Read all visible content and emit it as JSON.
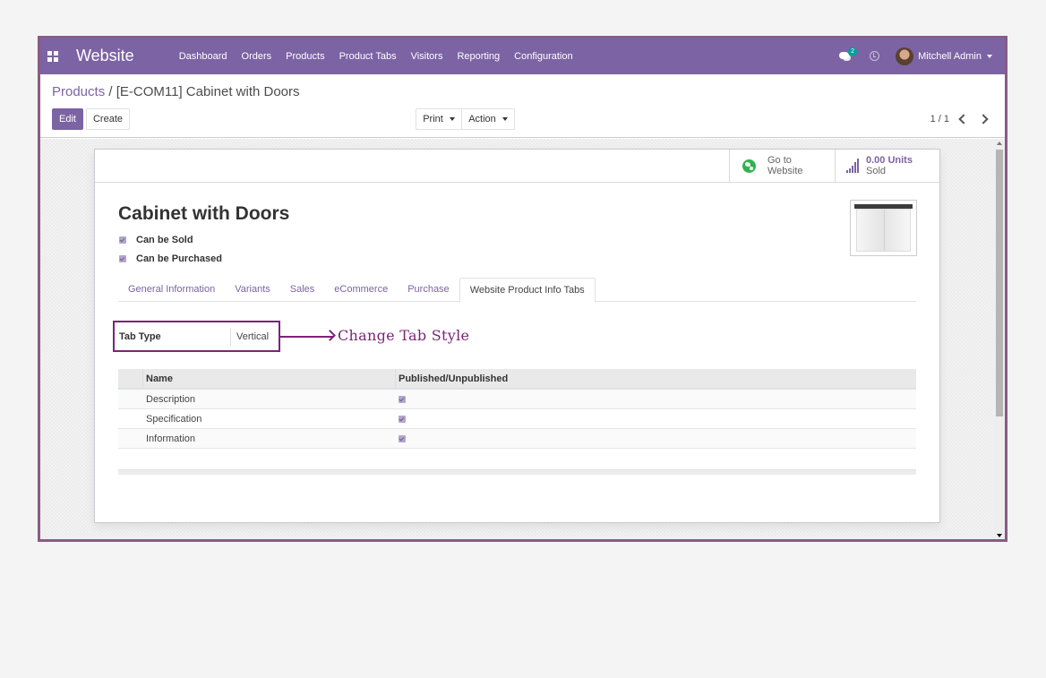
{
  "navbar": {
    "app_name": "Website",
    "menu": [
      "Dashboard",
      "Orders",
      "Products",
      "Product Tabs",
      "Visitors",
      "Reporting",
      "Configuration"
    ],
    "messages_count": "2",
    "user_name": "Mitchell Admin",
    "colors": {
      "brand": "#7c63a3",
      "badge": "#00a09d"
    }
  },
  "control_panel": {
    "breadcrumb_parent": "Products",
    "breadcrumb_separator": "/",
    "breadcrumb_current": "[E-COM11] Cabinet with Doors",
    "edit_label": "Edit",
    "create_label": "Create",
    "print_label": "Print",
    "action_label": "Action",
    "pager": "1 / 1"
  },
  "form": {
    "stat_buttons": {
      "website_line1": "Go to",
      "website_line2": "Website",
      "sold_value": "0.00 Units",
      "sold_label": "Sold"
    },
    "product_name": "Cabinet with Doors",
    "can_be_sold_label": "Can be Sold",
    "can_be_sold": true,
    "can_be_purchased_label": "Can be Purchased",
    "can_be_purchased": true,
    "tabs": [
      {
        "label": "General Information",
        "active": false
      },
      {
        "label": "Variants",
        "active": false
      },
      {
        "label": "Sales",
        "active": false
      },
      {
        "label": "eCommerce",
        "active": false
      },
      {
        "label": "Purchase",
        "active": false
      },
      {
        "label": "Website Product Info Tabs",
        "active": true
      }
    ],
    "tab_type_label": "Tab Type",
    "tab_type_value": "Vertical",
    "annotation": "Change Tab Style",
    "table": {
      "columns": [
        "Name",
        "Published/Unpublished"
      ],
      "rows": [
        {
          "name": "Description",
          "published": true
        },
        {
          "name": "Specification",
          "published": true
        },
        {
          "name": "Information",
          "published": true
        }
      ]
    }
  }
}
